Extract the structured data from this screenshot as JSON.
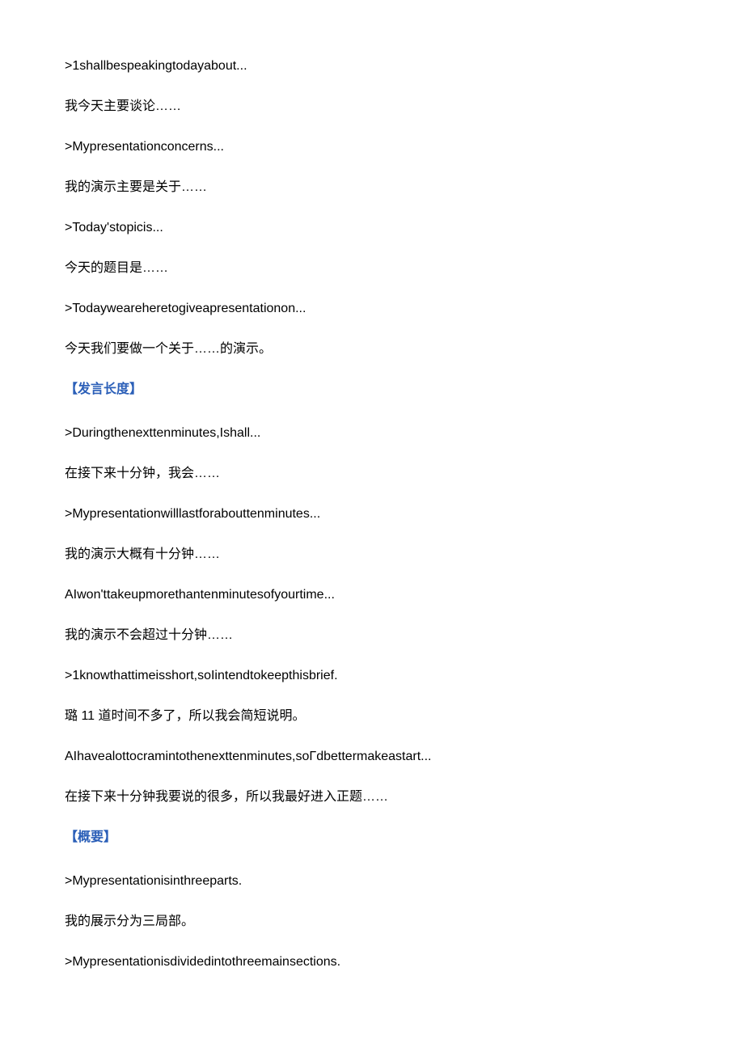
{
  "lines": [
    {
      "type": "text",
      "value": ">1shallbespeakingtodayabout..."
    },
    {
      "type": "text",
      "value": "我今天主要谈论……"
    },
    {
      "type": "text",
      "value": ">Mypresentationconcerns..."
    },
    {
      "type": "text",
      "value": "我的演示主要是关于……"
    },
    {
      "type": "text",
      "value": ">Today'stopicis..."
    },
    {
      "type": "text",
      "value": "今天的题目是……"
    },
    {
      "type": "text",
      "value": ">Todayweareheretogiveapresentationon..."
    },
    {
      "type": "text",
      "value": "今天我们要做一个关于……的演示。"
    },
    {
      "type": "heading",
      "value": "【发言长度】"
    },
    {
      "type": "text",
      "value": ">Duringthenexttenminutes,Ishall..."
    },
    {
      "type": "text",
      "value": "在接下来十分钟，我会……"
    },
    {
      "type": "text",
      "value": ">Mypresentationwilllastforabouttenminutes..."
    },
    {
      "type": "text",
      "value": "我的演示大概有十分钟……"
    },
    {
      "type": "text",
      "value": "AIwon'ttakeupmorethantenminutesofyourtime..."
    },
    {
      "type": "text",
      "value": "我的演示不会超过十分钟……"
    },
    {
      "type": "text",
      "value": ">1knowthattimeisshort,soIintendtokeepthisbrief."
    },
    {
      "type": "text",
      "value": "璐 11 道时间不多了，所以我会简短说明。"
    },
    {
      "type": "text",
      "value": "AIhavealottocramintothenexttenminutes,soΓdbettermakeastart..."
    },
    {
      "type": "text",
      "value": "在接下来十分钟我要说的很多，所以我最好进入正题……"
    },
    {
      "type": "heading",
      "value": "【概要】"
    },
    {
      "type": "text",
      "value": ">Mypresentationisinthreeparts."
    },
    {
      "type": "text",
      "value": "我的展示分为三局部。"
    },
    {
      "type": "text",
      "value": ">Mypresentationisdividedintothreemainsections."
    }
  ]
}
